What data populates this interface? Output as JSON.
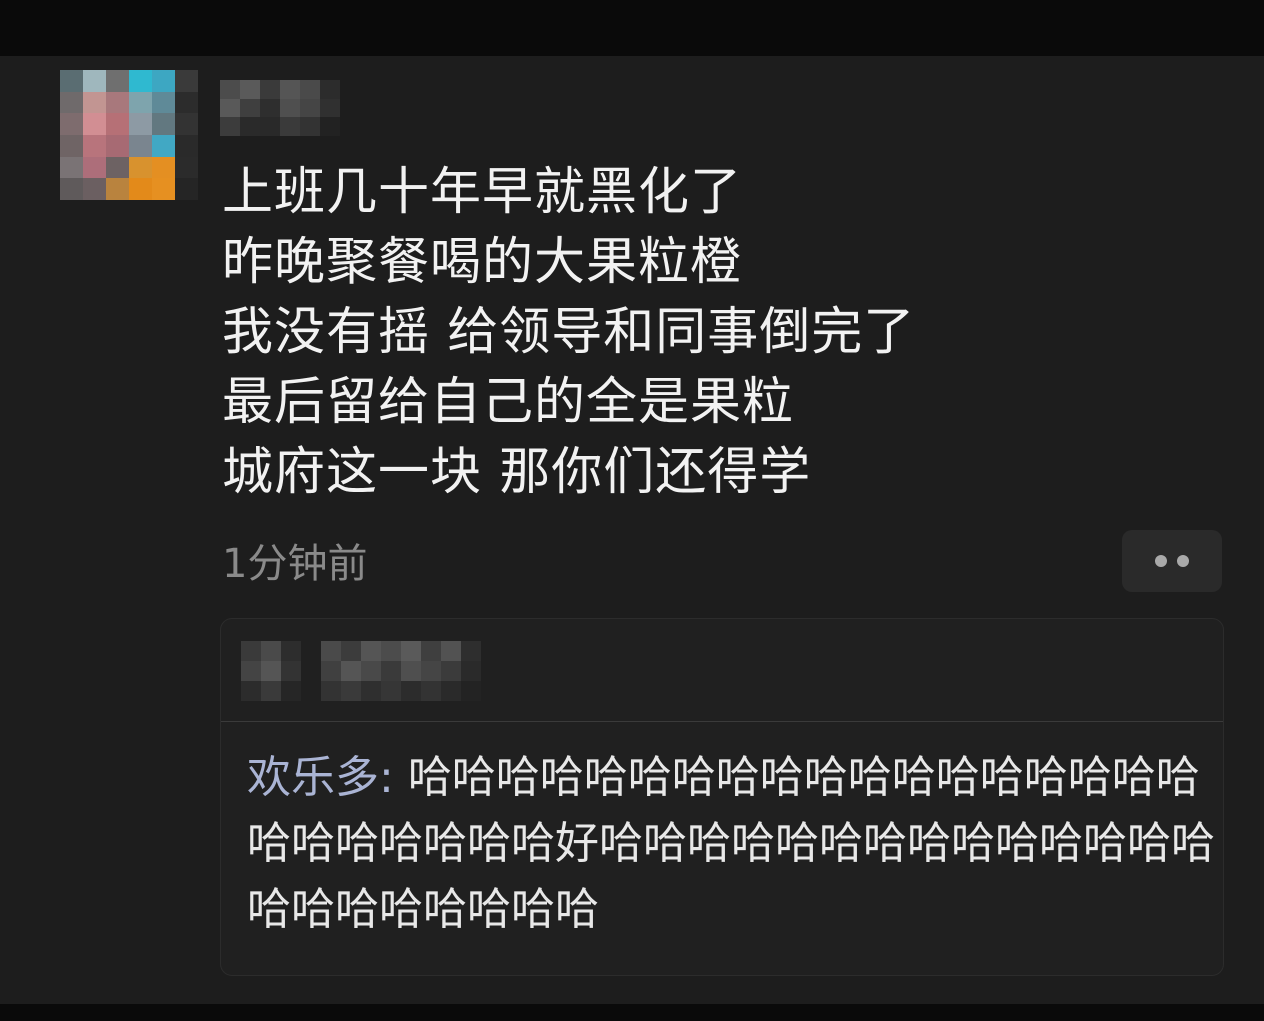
{
  "post": {
    "lines": [
      "上班几十年早就黑化了",
      "昨晚聚餐喝的大果粒橙",
      "我没有摇 给领导和同事倒完了",
      "最后留给自己的全是果粒",
      "城府这一块 那你们还得学"
    ],
    "timestamp": "1分钟前",
    "more_icon": "more-dots-icon"
  },
  "comment": {
    "author": "欢乐多",
    "separator": ": ",
    "text": "哈哈哈哈哈哈哈哈哈哈哈哈哈哈哈哈哈哈哈哈哈哈哈哈哈好哈哈哈哈哈哈哈哈哈哈哈哈哈哈哈哈哈哈哈哈哈哈"
  },
  "colors": {
    "background": "#1d1d1d",
    "text": "#f2f2f2",
    "muted": "#8a8a8a",
    "author": "#aab4d4"
  }
}
